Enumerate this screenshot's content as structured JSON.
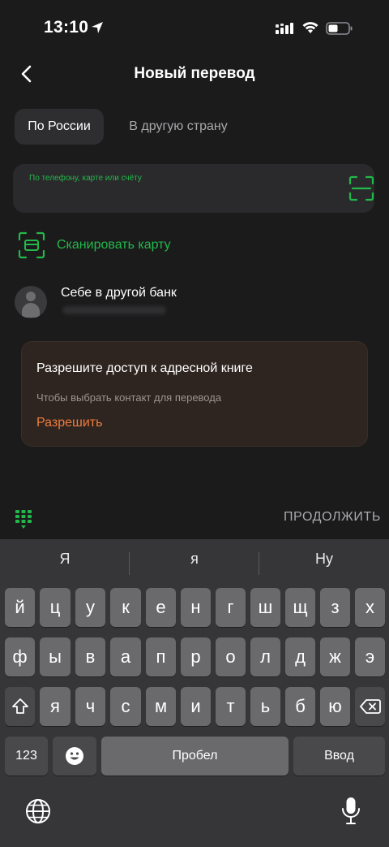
{
  "status_bar": {
    "time": "13:10",
    "icons": [
      "location-arrow-icon",
      "signal-icon",
      "wifi-icon",
      "battery-icon"
    ]
  },
  "header": {
    "back_icon": "chevron-left-icon",
    "title": "Новый перевод"
  },
  "tabs": [
    {
      "label": "По России",
      "active": true
    },
    {
      "label": "В другую страну",
      "active": false
    }
  ],
  "search": {
    "label": "По телефону, карте или счёту",
    "value": "",
    "scan_icon": "scan-frame-icon"
  },
  "scan_card": {
    "icon": "card-scan-icon",
    "label": "Сканировать карту"
  },
  "self_transfer": {
    "title": "Себе в другой банк"
  },
  "permission_card": {
    "title": "Разрешите доступ к адресной книге",
    "description": "Чтобы выбрать контакт для перевода",
    "action": "Разрешить"
  },
  "footer": {
    "numpad_icon": "numpad-grid-icon",
    "continue_label": "ПРОДОЛЖИТЬ"
  },
  "keyboard": {
    "suggestions": [
      "Я",
      "я",
      "Ну"
    ],
    "row1": [
      "й",
      "ц",
      "у",
      "к",
      "е",
      "н",
      "г",
      "ш",
      "щ",
      "з",
      "х"
    ],
    "row2": [
      "ф",
      "ы",
      "в",
      "а",
      "п",
      "р",
      "о",
      "л",
      "д",
      "ж",
      "э"
    ],
    "row3": [
      "я",
      "ч",
      "с",
      "м",
      "и",
      "т",
      "ь",
      "б",
      "ю"
    ],
    "numbers_key": "123",
    "space_key": "Пробел",
    "return_key": "Ввод",
    "icons": [
      "shift-icon",
      "backspace-icon",
      "emoji-icon",
      "globe-icon",
      "microphone-icon"
    ]
  },
  "colors": {
    "background": "#1b1b1c",
    "accent_green": "#23b84a",
    "accent_orange": "#ee7d3c",
    "permission_card_bg": "#2f2520"
  }
}
